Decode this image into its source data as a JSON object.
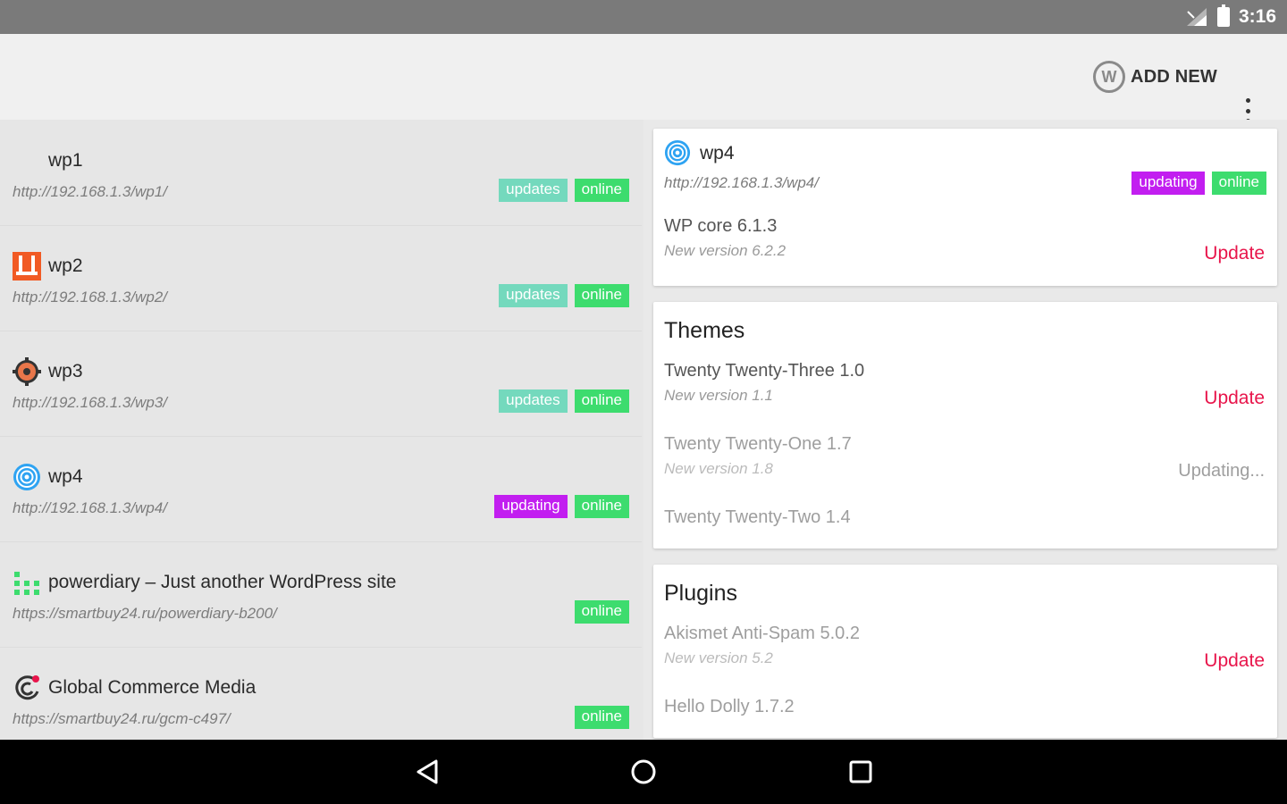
{
  "status_bar": {
    "time": "3:16"
  },
  "app_bar": {
    "add_new_label": "ADD NEW"
  },
  "sites": [
    {
      "name": "wp1",
      "url": "http://192.168.1.3/wp1/",
      "badges": [
        {
          "label": "updates",
          "kind": "updates"
        },
        {
          "label": "online",
          "kind": "online"
        }
      ],
      "icon": "blank-icon"
    },
    {
      "name": "wp2",
      "url": "http://192.168.1.3/wp2/",
      "badges": [
        {
          "label": "updates",
          "kind": "updates"
        },
        {
          "label": "online",
          "kind": "online"
        }
      ],
      "icon": "orange-logo-icon"
    },
    {
      "name": "wp3",
      "url": "http://192.168.1.3/wp3/",
      "badges": [
        {
          "label": "updates",
          "kind": "updates"
        },
        {
          "label": "online",
          "kind": "online"
        }
      ],
      "icon": "gear-logo-icon"
    },
    {
      "name": "wp4",
      "url": "http://192.168.1.3/wp4/",
      "badges": [
        {
          "label": "updating",
          "kind": "updating"
        },
        {
          "label": "online",
          "kind": "online"
        }
      ],
      "icon": "spiral-logo-icon"
    },
    {
      "name": "powerdiary – Just another WordPress site",
      "url": "https://smartbuy24.ru/powerdiary-b200/",
      "badges": [
        {
          "label": "online",
          "kind": "online"
        }
      ],
      "icon": "dots-logo-icon"
    },
    {
      "name": "Global Commerce Media",
      "url": "https://smartbuy24.ru/gcm-c497/",
      "badges": [
        {
          "label": "online",
          "kind": "online"
        }
      ],
      "icon": "gcm-logo-icon"
    }
  ],
  "detail": {
    "site_name": "wp4",
    "site_url": "http://192.168.1.3/wp4/",
    "badge_updating": "updating",
    "badge_online": "online",
    "core": {
      "name": "WP core 6.1.3",
      "new_version": "New version 6.2.2",
      "action": "Update"
    },
    "themes": {
      "title": "Themes",
      "items": [
        {
          "name": "Twenty Twenty-Three 1.0",
          "new_version": "New version 1.1",
          "action": "Update"
        },
        {
          "name": "Twenty Twenty-One 1.7",
          "new_version": "New version 1.8",
          "status": "Updating..."
        },
        {
          "name": "Twenty Twenty-Two 1.4"
        }
      ]
    },
    "plugins": {
      "title": "Plugins",
      "items": [
        {
          "name": "Akismet Anti-Spam 5.0.2",
          "new_version": "New version 5.2",
          "action": "Update"
        },
        {
          "name": "Hello Dolly 1.7.2"
        }
      ]
    }
  },
  "colors": {
    "updates": "#74d9bd",
    "online": "#3ddc6e",
    "updating": "#c21ef0",
    "update_link": "#e8154b"
  }
}
